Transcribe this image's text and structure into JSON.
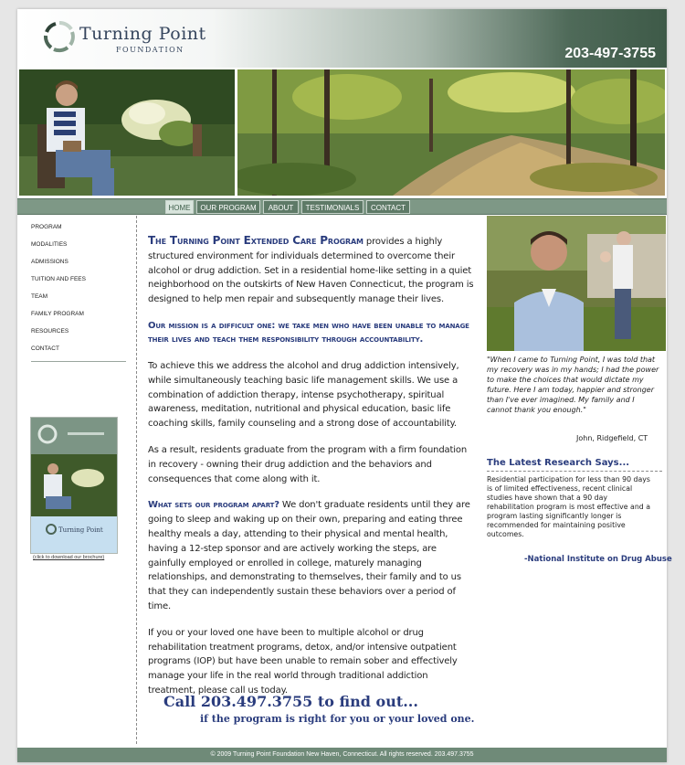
{
  "header": {
    "logo_name": "Turning Point",
    "logo_sub": "FOUNDATION",
    "phone": "203-497-3755"
  },
  "nav": {
    "items": [
      {
        "label": "HOME",
        "active": true
      },
      {
        "label": "OUR PROGRAM",
        "active": false
      },
      {
        "label": "ABOUT",
        "active": false
      },
      {
        "label": "TESTIMONIALS",
        "active": false
      },
      {
        "label": "CONTACT",
        "active": false
      }
    ]
  },
  "sidebar": {
    "items": [
      {
        "label": "PROGRAM"
      },
      {
        "label": "MODALITIES"
      },
      {
        "label": "ADMISSIONS"
      },
      {
        "label": "TUITION AND FEES"
      },
      {
        "label": "TEAM"
      },
      {
        "label": "FAMILY PROGRAM"
      },
      {
        "label": "RESOURCES"
      },
      {
        "label": "CONTACT"
      }
    ],
    "brochure_logo": "Turning Point",
    "brochure_link": "(click to download our brochure)"
  },
  "main": {
    "p1_lead": "The Turning Point Extended Care Program",
    "p1_body": " provides a highly structured environment for individuals determined to overcome their alcohol or drug addiction. Set in a residential home-like setting in a quiet neighborhood on the outskirts of New Haven Connecticut, the program is designed to help men repair and subsequently manage their lives.",
    "mission": "Our mission is a difficult one: we take men who have been unable to manage their lives and teach them responsibility through accountability.",
    "p2": "To achieve this we address the alcohol and drug addiction intensively, while simultaneously teaching basic life management skills. We use a combination of addiction therapy, intense psychotherapy, spiritual awareness, meditation, nutritional and physical education, basic life coaching skills, family counseling and a strong dose of accountability.",
    "p3": "As a result, residents graduate from the program with a firm foundation in recovery - owning their drug addiction and the behaviors and consequences that come along with it.",
    "p4_lead": "What sets our program apart?",
    "p4_body": " We don't graduate residents until they are going to sleep and waking up on their own, preparing and eating three healthy meals a day, attending to their physical and mental health, having a 12-step sponsor and are actively working the steps, are gainfully employed or enrolled in college, maturely managing relationships, and demonstrating to themselves, their family and to us that they can independently sustain these behaviors over a period of time.",
    "p5": "If you or your loved one have been to multiple alcohol or drug rehabilitation treatment programs, detox, and/or intensive outpatient programs (IOP) but have been unable to remain sober and effectively manage your life in the real world through traditional addiction treatment, please call us today.",
    "cta_line1": "Call 203.497.3755 to find out...",
    "cta_line2": "if the program is right for you or your loved one."
  },
  "right": {
    "quote": "\"When I came to Turning Point, I was told that my recovery was in my hands; I had the power to make the choices that would dictate my future. Here I am today, happier and stronger than I've ever imagined. My family and I cannot thank you enough.\"",
    "quote_author": "John, Ridgefield, CT",
    "research_title": "The Latest Research Says...",
    "research_body": "Residential participation for less than 90 days is of limited effectiveness, recent clinical studies have shown that a 90 day rehabilitation program is most effective and a program lasting significantly longer is recommended for maintaining positive outcomes.",
    "research_source": "-National Institute on Drug Abuse"
  },
  "footer": {
    "text": "© 2009 Turning Point Foundation New Haven, Connecticut. All rights reserved. 203.497.3755"
  },
  "colors": {
    "accent_blue": "#2a3c7d",
    "nav_green": "#7e9886",
    "header_dark_green": "#3e5a48"
  }
}
